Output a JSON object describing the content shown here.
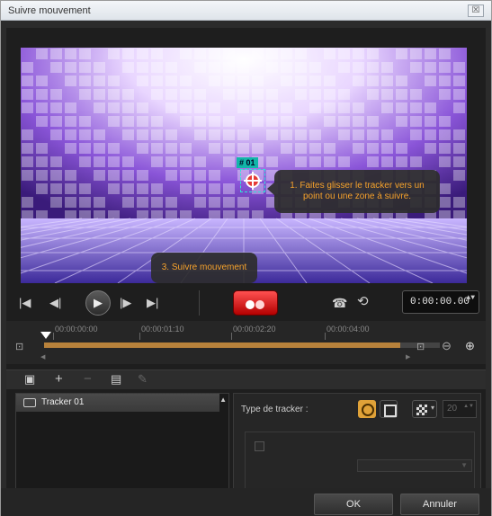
{
  "window": {
    "title": "Suivre mouvement",
    "close_label": "☒"
  },
  "preview": {
    "tracker_id": "# 01",
    "callout_1": "1. Faites glisser le tracker vers un point ou une zone à suivre.",
    "callout_3": "3. Suivre mouvement"
  },
  "transport": {
    "goto_start": "|◀",
    "prev_frame": "◀|",
    "play": "▶",
    "next_frame": "|▶",
    "goto_end": "▶|",
    "phone_icon": "☎",
    "history_icon": "⟲",
    "timecode": "0:00:00.00",
    "timecode_spin": "▲▼"
  },
  "timeline": {
    "ruler": [
      "00:00:00:00",
      "00:00:01:10",
      "00:00:02:20",
      "00:00:04:00"
    ],
    "progress": 0.9,
    "scroll_left": "◀",
    "scroll_right": "▶"
  },
  "panel_toolbar": {
    "camera": "▣",
    "add": "+",
    "remove": "−",
    "film": "▤",
    "edit": "✎"
  },
  "tracker_list": {
    "items": [
      {
        "label": "Tracker 01"
      }
    ],
    "scroll_up": "▲",
    "scroll_down": "▼"
  },
  "properties": {
    "tracker_type_label": "Type de tracker :",
    "area_size_value": "20",
    "spin": "▲▼",
    "dropdown_arrow": "▼"
  },
  "footer": {
    "ok_label": "OK",
    "cancel_label": "Annuler"
  },
  "colors": {
    "accent": "#e0a238",
    "record": "#e02020",
    "tracker": "#11b6a9",
    "callout_text": "#f6a22b"
  }
}
